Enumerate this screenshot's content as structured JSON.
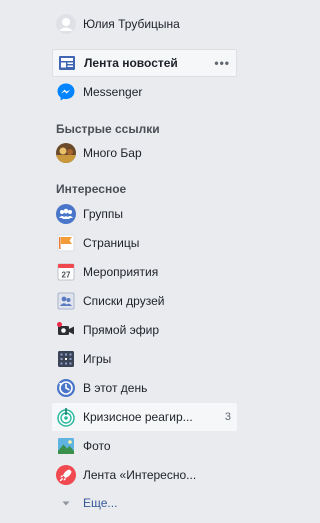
{
  "profile": {
    "name": "Юлия Трубицына"
  },
  "nav": {
    "news_feed": {
      "label": "Лента новостей",
      "more": "•••"
    },
    "messenger": {
      "label": "Messenger"
    }
  },
  "shortcuts": {
    "title": "Быстрые ссылки",
    "items": [
      {
        "label": "Много Бар"
      }
    ]
  },
  "explore": {
    "title": "Интересное",
    "items": [
      {
        "label": "Группы"
      },
      {
        "label": "Страницы"
      },
      {
        "label": "Мероприятия",
        "calendar_day": "27"
      },
      {
        "label": "Списки друзей"
      },
      {
        "label": "Прямой эфир"
      },
      {
        "label": "Игры"
      },
      {
        "label": "В этот день"
      },
      {
        "label": "Кризисное реагир...",
        "count": "3"
      },
      {
        "label": "Фото"
      },
      {
        "label": "Лента «Интересно..."
      }
    ],
    "see_more": "Еще..."
  },
  "colors": {
    "background": "#e9ebee",
    "link": "#365899",
    "fb_blue": "#4267b2",
    "messenger_blue": "#0084ff"
  }
}
